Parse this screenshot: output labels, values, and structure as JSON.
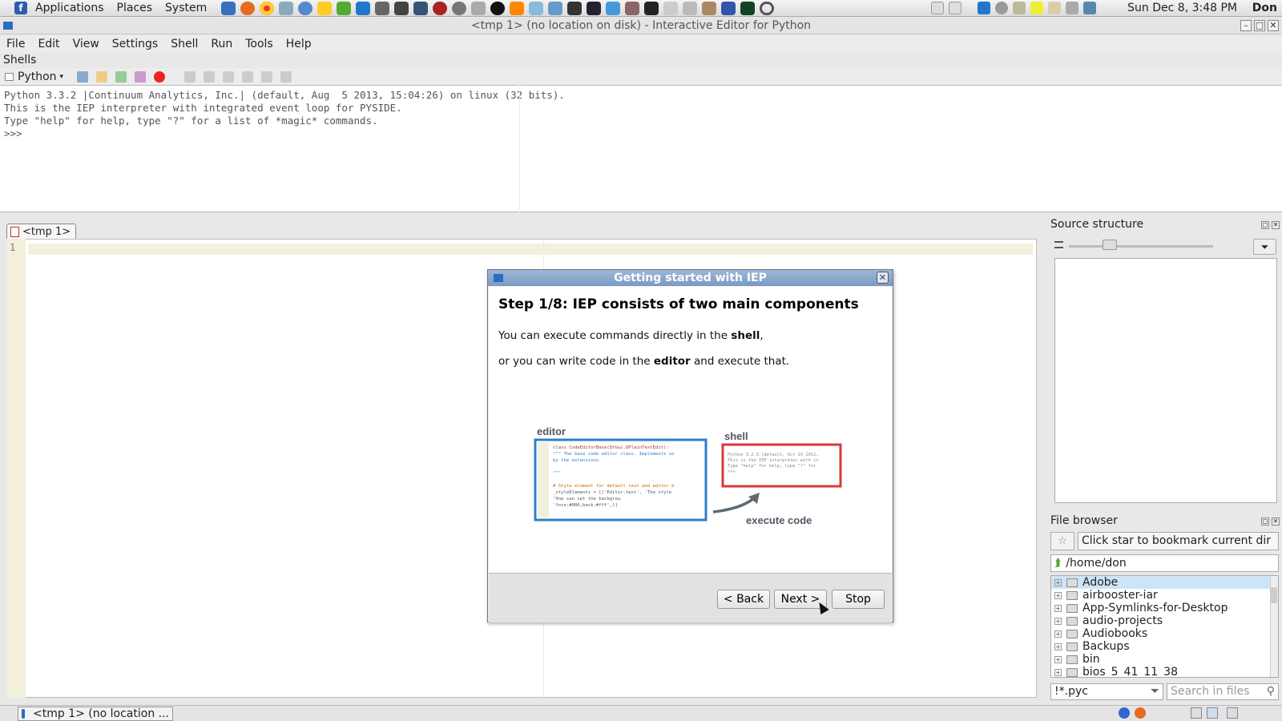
{
  "panel": {
    "menus": [
      "Applications",
      "Places",
      "System"
    ],
    "clock": "Sun Dec  8,  3:48 PM",
    "user": "Don"
  },
  "window": {
    "title": "<tmp 1> (no location on disk) - Interactive Editor for Python"
  },
  "menubar": [
    "File",
    "Edit",
    "View",
    "Settings",
    "Shell",
    "Run",
    "Tools",
    "Help"
  ],
  "shells": {
    "title": "Shells",
    "tab_label": "Python",
    "lines": [
      "Python 3.3.2 |Continuum Analytics, Inc.| (default, Aug  5 2013, 15:04:26) on linux (32 bits).",
      "This is the IEP interpreter with integrated event loop for PYSIDE.",
      "Type \"help\" for help, type \"?\" for a list of *magic* commands.",
      ">>> "
    ]
  },
  "editor": {
    "tab_label": "<tmp 1>",
    "line_number": "1"
  },
  "source_structure": {
    "title": "Source structure"
  },
  "file_browser": {
    "title": "File browser",
    "bookmark_text": "Click star to bookmark current dir",
    "path": "/home/don",
    "items": [
      "Adobe",
      "airbooster-iar",
      "App-Symlinks-for-Desktop",
      "audio-projects",
      "Audiobooks",
      "Backups",
      "bin",
      "bios_5_41_11_38"
    ],
    "filter": "!*.pyc",
    "search_placeholder": "Search in files"
  },
  "dialog": {
    "title": "Getting started with IEP",
    "step": "Step 1/8: IEP consists of two main components",
    "line1_pre": "You can execute commands directly in the ",
    "line1_bold": "shell",
    "line1_post": ",",
    "line2_pre": "or you can write code in the ",
    "line2_bold": "editor",
    "line2_post": " and execute that.",
    "diagram": {
      "editor_label": "editor",
      "shell_label": "shell",
      "execute_label": "execute code",
      "code_lines": [
        "class CodeEditorBase(QtGui.QPlainTextEdit):",
        "    \"\"\" The base code editor class. Implements so",
        "    by the extensions.",
        "",
        "    \"\"\"",
        "",
        "    # Style element for default text and editor b",
        "    _styleElements = [('Editor.text', 'The style",
        "                       'One can set the backgrou",
        "                       'fore:#000,back:#fff',)]"
      ],
      "shell_lines": [
        "Python 3.2.3 (default, Oct 19 2012,",
        "This is the IEP interpreter with in",
        "Type \"help\" for help, type \"?\" for",
        ">>>"
      ]
    },
    "buttons": {
      "back": "< Back",
      "next": "Next >",
      "stop": "Stop"
    }
  },
  "taskbar": {
    "task_label": "<tmp 1> (no location ..."
  },
  "colors": {
    "editor_blue": "#2a7fc9",
    "shell_red": "#d9383c",
    "selection": "#cde4f7"
  }
}
